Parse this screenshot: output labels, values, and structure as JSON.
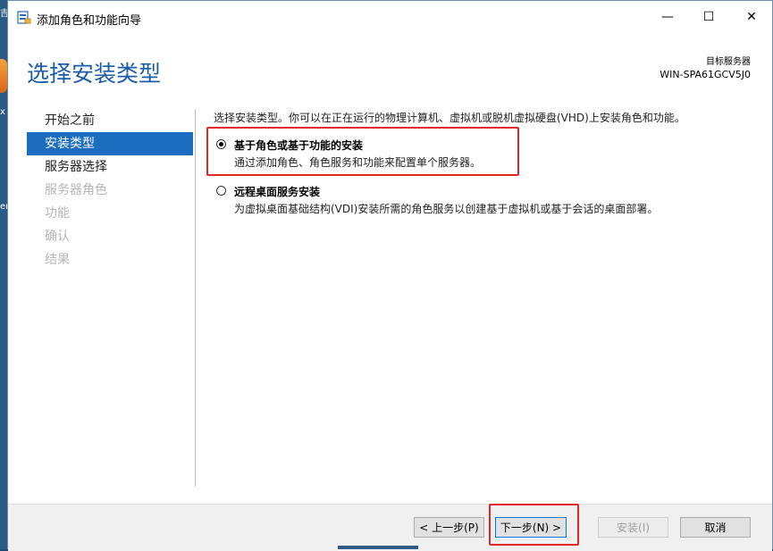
{
  "window": {
    "title": "添加角色和功能向导",
    "controls": {
      "minimize": "—",
      "maximize": "☐",
      "close": "✕"
    },
    "icon": "server-manager-icon"
  },
  "desktop": {
    "label_top": "吉",
    "label_mid": "x",
    "label_low": "er"
  },
  "header": {
    "page_title": "选择安装类型",
    "target_label": "目标服务器",
    "target_value": "WIN-SPA61GCV5J0"
  },
  "nav": {
    "items": [
      {
        "label": "开始之前",
        "state": "normal"
      },
      {
        "label": "安装类型",
        "state": "active"
      },
      {
        "label": "服务器选择",
        "state": "normal"
      },
      {
        "label": "服务器角色",
        "state": "disabled"
      },
      {
        "label": "功能",
        "state": "disabled"
      },
      {
        "label": "确认",
        "state": "disabled"
      },
      {
        "label": "结果",
        "state": "disabled"
      }
    ]
  },
  "main": {
    "intro": "选择安装类型。你可以在正在运行的物理计算机、虚拟机或脱机虚拟硬盘(VHD)上安装角色和功能。",
    "options": [
      {
        "title": "基于角色或基于功能的安装",
        "desc": "通过添加角色、角色服务和功能来配置单个服务器。",
        "selected": true
      },
      {
        "title": "远程桌面服务安装",
        "desc": "为虚拟桌面基础结构(VDI)安装所需的角色服务以创建基于虚拟机或基于会话的桌面部署。",
        "selected": false
      }
    ]
  },
  "footer": {
    "prev": "< 上一步(P)",
    "next": "下一步(N) >",
    "install": "安装(I)",
    "cancel": "取消"
  },
  "colors": {
    "accent": "#1c6cc0",
    "title": "#1a5ca8",
    "highlight": "#e2262b"
  }
}
